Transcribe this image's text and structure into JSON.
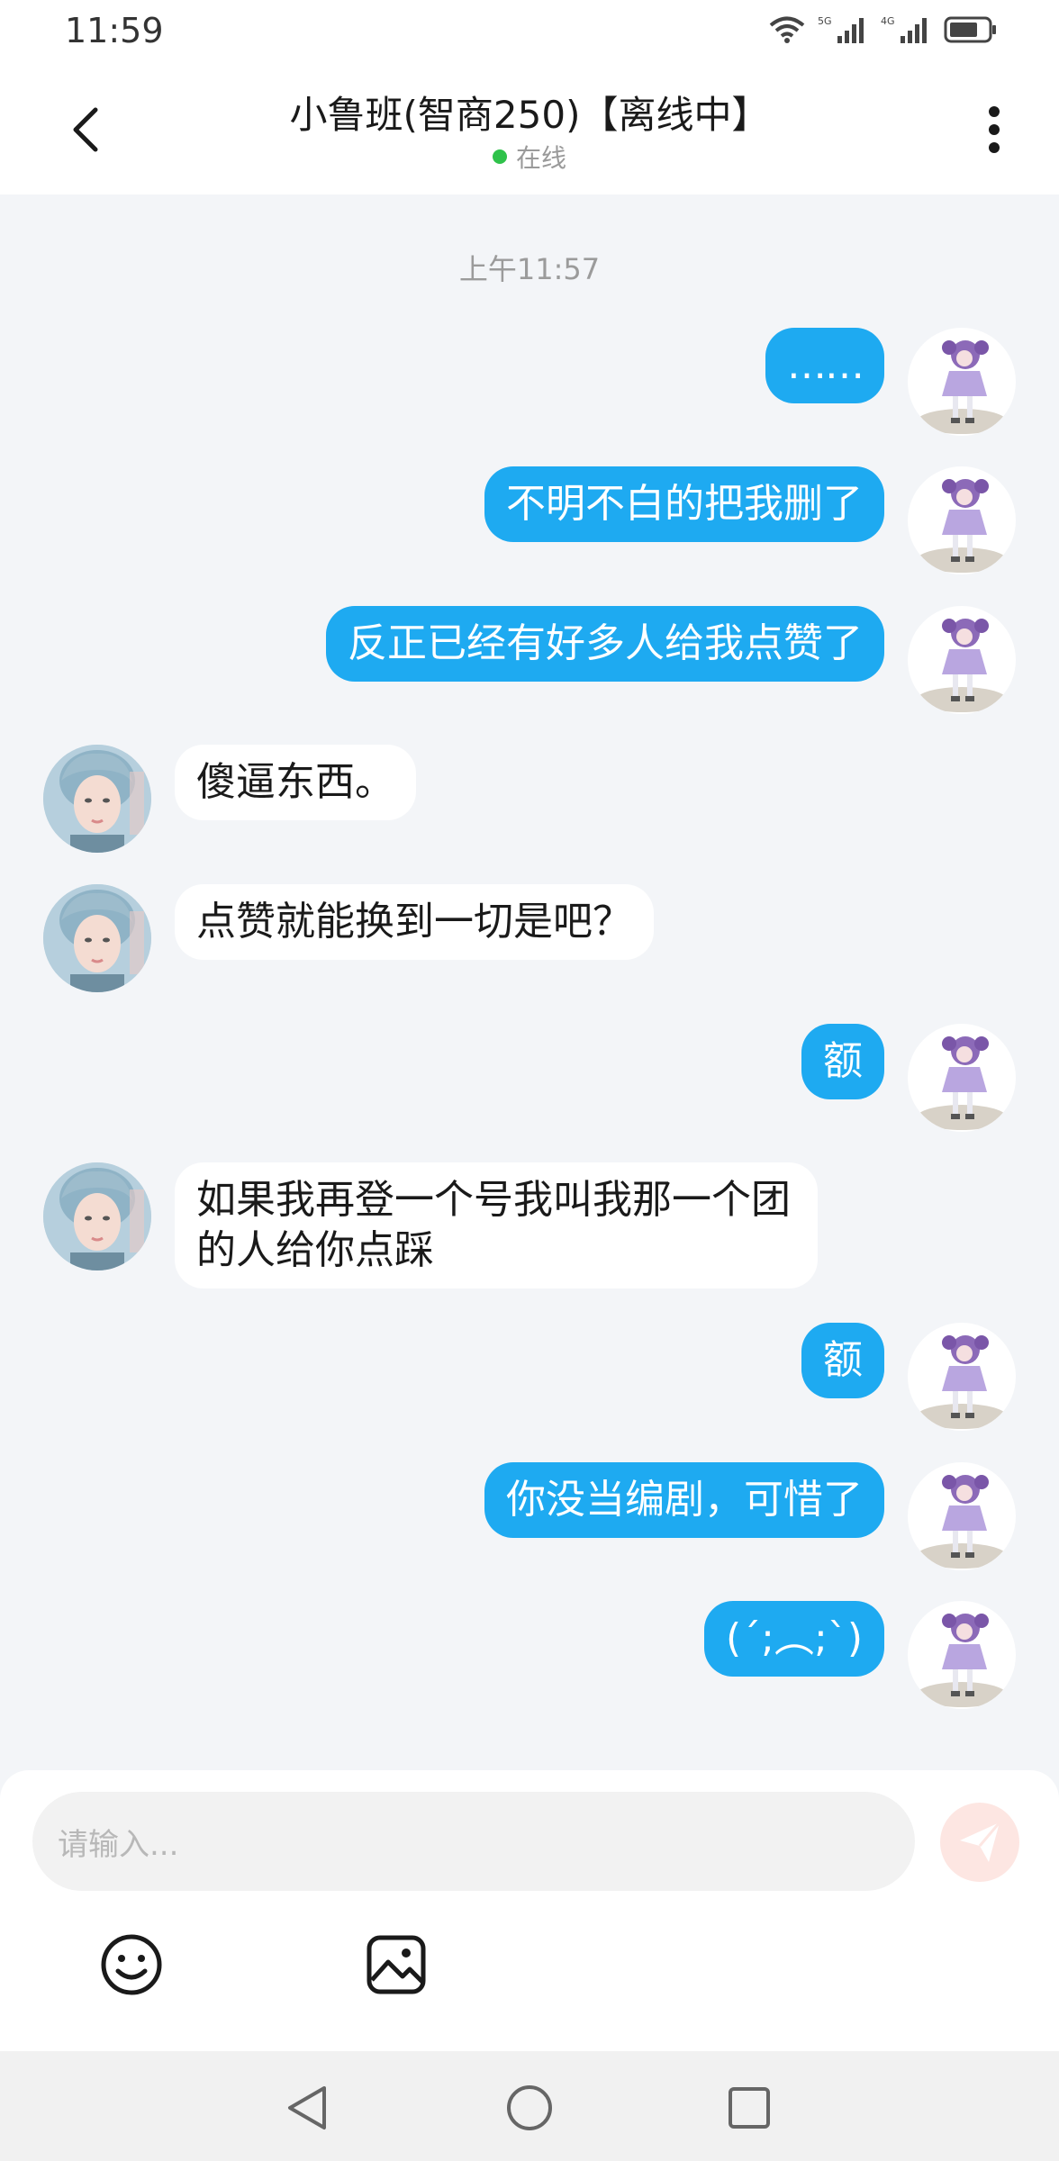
{
  "status_bar": {
    "time": "11:59",
    "icons": [
      "wifi-icon",
      "signal-5g-icon",
      "signal-4g-icon",
      "battery-icon"
    ],
    "net_labels": [
      "5G",
      "4G"
    ]
  },
  "header": {
    "title": "小鲁班(智商250)【离线中】",
    "presence": "在线",
    "presence_color": "#2fc24a"
  },
  "chat": {
    "timestamp": "上午11:57",
    "messages": [
      {
        "side": "me",
        "text": "……"
      },
      {
        "side": "me",
        "text": "不明不白的把我删了"
      },
      {
        "side": "me",
        "text": "反正已经有好多人给我点赞了"
      },
      {
        "side": "them",
        "text": "傻逼东西。"
      },
      {
        "side": "them",
        "text": "点赞就能换到一切是吧？"
      },
      {
        "side": "me",
        "text": "额"
      },
      {
        "side": "them",
        "text": "如果我再登一个号我叫我那一个团的人给你点踩"
      },
      {
        "side": "me",
        "text": "额"
      },
      {
        "side": "me",
        "text": "你没当编剧，可惜了"
      },
      {
        "side": "me",
        "text": "(´;︵;`)"
      }
    ]
  },
  "input": {
    "placeholder": "请输入..."
  },
  "colors": {
    "accent": "#1eaaf1",
    "background": "#f3f5f8",
    "send_button": "#fde6e2"
  }
}
